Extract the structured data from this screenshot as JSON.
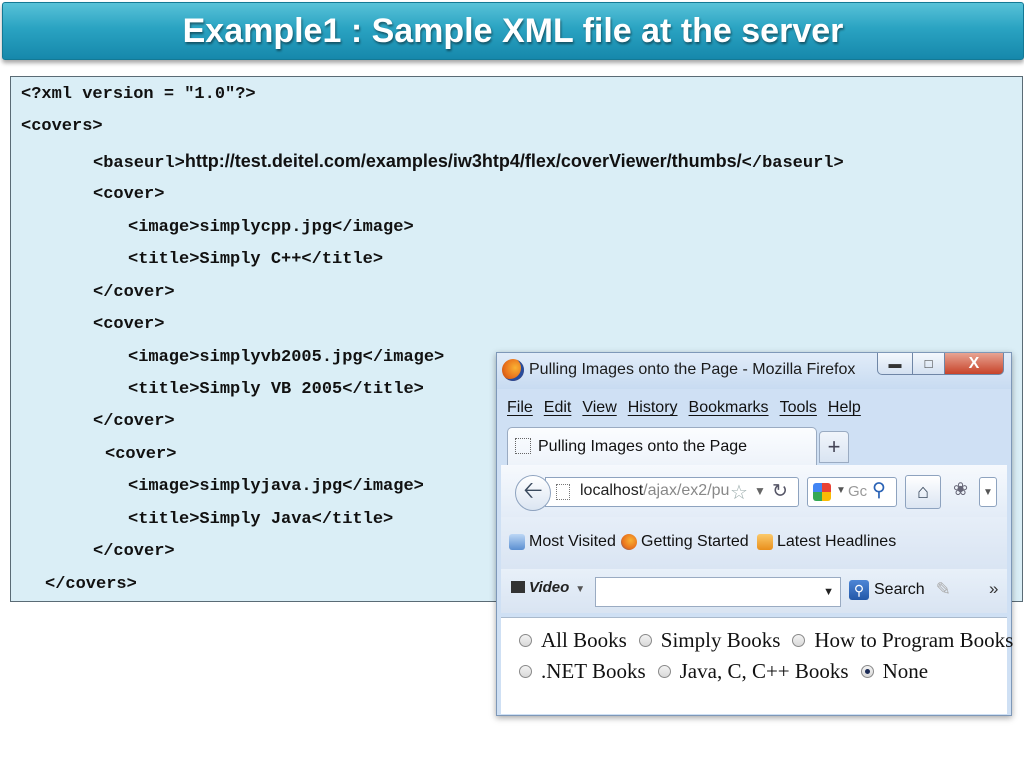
{
  "slide": {
    "title": "Example1 : Sample XML file at the server"
  },
  "code": {
    "lines": [
      "<?xml version = \"1.0\"?>",
      "<covers>",
      "<baseurl>",
      "http://test.deitel.com/examples/iw3htp4/flex/coverViewer/thumbs/",
      "</baseurl>",
      "<cover>",
      "<image>simplycpp.jpg</image>",
      "<title>Simply C++</title>",
      "</cover>",
      "<cover>",
      "<image>simplyvb2005.jpg</image>",
      "<title>Simply VB 2005</title>",
      "</cover>",
      "<cover>",
      "<image>simplyjava.jpg</image>",
      "<title>Simply Java</title>",
      "</cover>",
      "</covers>"
    ]
  },
  "browser": {
    "window_title": "Pulling Images onto the Page - Mozilla Firefox",
    "close_glyph": "X",
    "menu": [
      "File",
      "Edit",
      "View",
      "History",
      "Bookmarks",
      "Tools",
      "Help"
    ],
    "tab_label": "Pulling Images onto the Page",
    "new_tab_glyph": "+",
    "url_host": "localhost",
    "url_rest": "/ajax/ex2/pu",
    "search_text": "Gc",
    "bookmarks": [
      "Most Visited",
      "Getting Started",
      "Latest Headlines"
    ],
    "video_label": "Video",
    "search_button": "Search",
    "overflow_glyph": "»",
    "radio_options": [
      {
        "label": "All Books",
        "checked": false
      },
      {
        "label": "Simply Books",
        "checked": false
      },
      {
        "label": "How to Program Books",
        "checked": false
      },
      {
        "label": ".NET Books",
        "checked": false
      },
      {
        "label": "Java, C, C++ Books",
        "checked": false
      },
      {
        "label": "None",
        "checked": true
      }
    ],
    "icons": {
      "window": "firefox-logo-icon",
      "back": "back-arrow-icon",
      "bookmark_star": "star-icon",
      "reload": "reload-icon",
      "search_engine": "google-icon",
      "search": "magnifier-icon",
      "home": "home-icon"
    }
  }
}
